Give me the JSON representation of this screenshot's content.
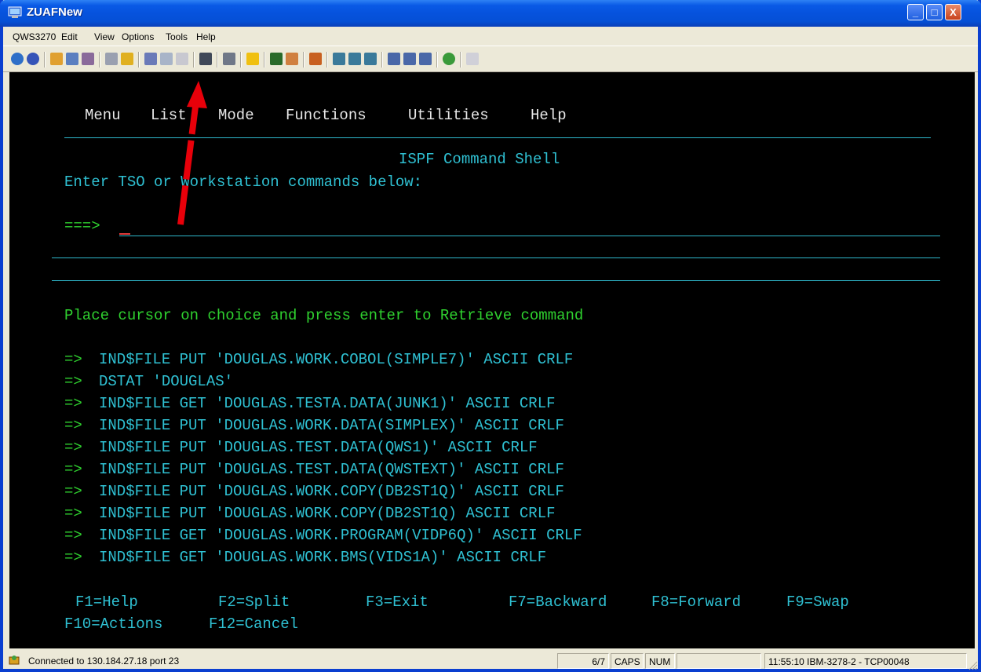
{
  "window": {
    "title": "ZUAFNew",
    "minimize_label": "_",
    "maximize_label": "□",
    "close_label": "X"
  },
  "menubar": {
    "items": [
      {
        "label": "QWS3270"
      },
      {
        "label": "Edit"
      },
      {
        "label": "View"
      },
      {
        "label": "Options"
      },
      {
        "label": "Tools"
      },
      {
        "label": "Help"
      }
    ]
  },
  "terminal": {
    "menu": {
      "items": [
        {
          "label": "Menu"
        },
        {
          "label": "List"
        },
        {
          "label": "Mode"
        },
        {
          "label": "Functions"
        },
        {
          "label": "Utilities"
        },
        {
          "label": "Help"
        }
      ]
    },
    "panel_title": "ISPF Command Shell",
    "instruction": "Enter TSO or Workstation commands below:",
    "prompt": "===>",
    "command_value": "",
    "retrieve_hint": "Place cursor on choice and press enter to Retrieve command",
    "history": [
      {
        "marker": "=>",
        "command": "IND$FILE PUT 'DOUGLAS.WORK.COBOL(SIMPLE7)' ASCII CRLF"
      },
      {
        "marker": "=>",
        "command": "DSTAT 'DOUGLAS'"
      },
      {
        "marker": "=>",
        "command": "IND$FILE GET 'DOUGLAS.TESTA.DATA(JUNK1)' ASCII CRLF"
      },
      {
        "marker": "=>",
        "command": "IND$FILE PUT 'DOUGLAS.WORK.DATA(SIMPLEX)' ASCII CRLF"
      },
      {
        "marker": "=>",
        "command": "IND$FILE PUT 'DOUGLAS.TEST.DATA(QWS1)' ASCII CRLF"
      },
      {
        "marker": "=>",
        "command": "IND$FILE PUT 'DOUGLAS.TEST.DATA(QWSTEXT)' ASCII CRLF"
      },
      {
        "marker": "=>",
        "command": "IND$FILE PUT 'DOUGLAS.WORK.COPY(DB2ST1Q)' ASCII CRLF"
      },
      {
        "marker": "=>",
        "command": "IND$FILE PUT 'DOUGLAS.WORK.COPY(DB2ST1Q) ASCII CRLF"
      },
      {
        "marker": "=>",
        "command": "IND$FILE GET 'DOUGLAS.WORK.PROGRAM(VIDP6Q)' ASCII CRLF"
      },
      {
        "marker": "=>",
        "command": "IND$FILE GET 'DOUGLAS.WORK.BMS(VIDS1A)' ASCII CRLF"
      }
    ],
    "fkeys_row1": [
      {
        "label": "F1=Help"
      },
      {
        "label": "F2=Split"
      },
      {
        "label": "F3=Exit"
      },
      {
        "label": "F7=Backward"
      },
      {
        "label": "F8=Forward"
      },
      {
        "label": "F9=Swap"
      }
    ],
    "fkeys_row2": [
      {
        "label": "F10=Actions"
      },
      {
        "label": "F12=Cancel"
      }
    ]
  },
  "statusbar": {
    "connection": "Connected to 130.184.27.18 port 23",
    "cursor_pos": "6/7",
    "caps": "CAPS",
    "num": "NUM",
    "ins": "",
    "session": "11:55:10 IBM-3278-2 - TCP00048"
  },
  "colors": {
    "terminal_cyan": "#2FC0D2",
    "terminal_green": "#2FD12F",
    "annotation_arrow": "#E8000A"
  }
}
